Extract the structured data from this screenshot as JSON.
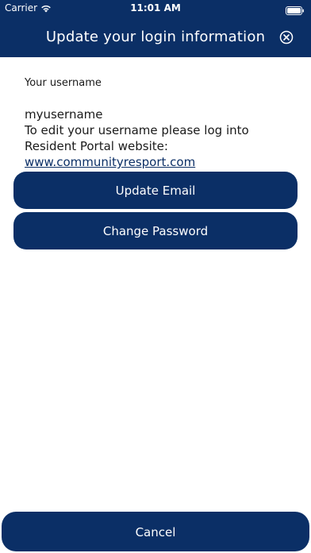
{
  "status_bar": {
    "carrier": "Carrier",
    "time": "11:01 AM",
    "wifi_icon": "wifi-icon",
    "battery_icon": "battery-icon"
  },
  "header": {
    "title": "Update your login information",
    "close_icon": "close-circle-icon",
    "background_color": "#0b2f66"
  },
  "account": {
    "username_label": "Your username",
    "username_value": "myusername",
    "edit_note_text": "To edit your username please log into Resident Portal website: ",
    "website_link": "www.communityresport.com"
  },
  "actions": {
    "update_email": "Update Email",
    "change_password": "Change Password",
    "cancel": "Cancel"
  },
  "colors": {
    "accent": "#0b2f66",
    "text": "#1a1a1a",
    "background": "#ffffff"
  }
}
